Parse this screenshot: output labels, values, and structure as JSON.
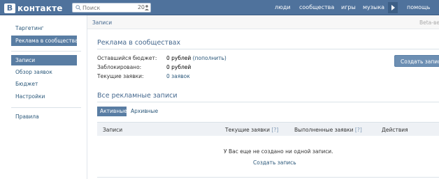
{
  "topbar": {
    "logo_text": "контакте",
    "logo_letter": "В",
    "search_placeholder": "Поиск",
    "search_count": "20",
    "nav": [
      "люди",
      "сообщества",
      "игры",
      "музыка",
      "помощь"
    ]
  },
  "sidebar": {
    "items_top": [
      "Таргетинг",
      "Реклама в сообществах"
    ],
    "items_mid": [
      "Записи",
      "Обзор заявок",
      "Бюджет",
      "Настройки"
    ],
    "items_bottom": [
      "Правила"
    ]
  },
  "main": {
    "header_title": "Записи",
    "beta": "Beta-ве",
    "ads_title": "Реклама в сообществах",
    "rows": [
      {
        "label": "Оставшийся бюджет:",
        "value": "0 рублей",
        "link": "(пополнить)"
      },
      {
        "label": "Заблокировано:",
        "value": "0 рублей",
        "link": ""
      },
      {
        "label": "Текущие заявки:",
        "value": "",
        "link": "0 заявок"
      }
    ],
    "create_button": "Создать запись",
    "all_title": "Все рекламные записи",
    "tabs": [
      "Активные",
      "Архивные"
    ],
    "columns": [
      "Записи",
      "Текущие заявки",
      "Выполненные заявки",
      "Действия"
    ],
    "help_mark": "[?]",
    "empty_message": "У Вас еще не создано ни одной записи.",
    "empty_link": "Создать запись"
  },
  "colors": {
    "topbar": "#4f729c",
    "accent": "#597da3",
    "link": "#2b587a"
  }
}
